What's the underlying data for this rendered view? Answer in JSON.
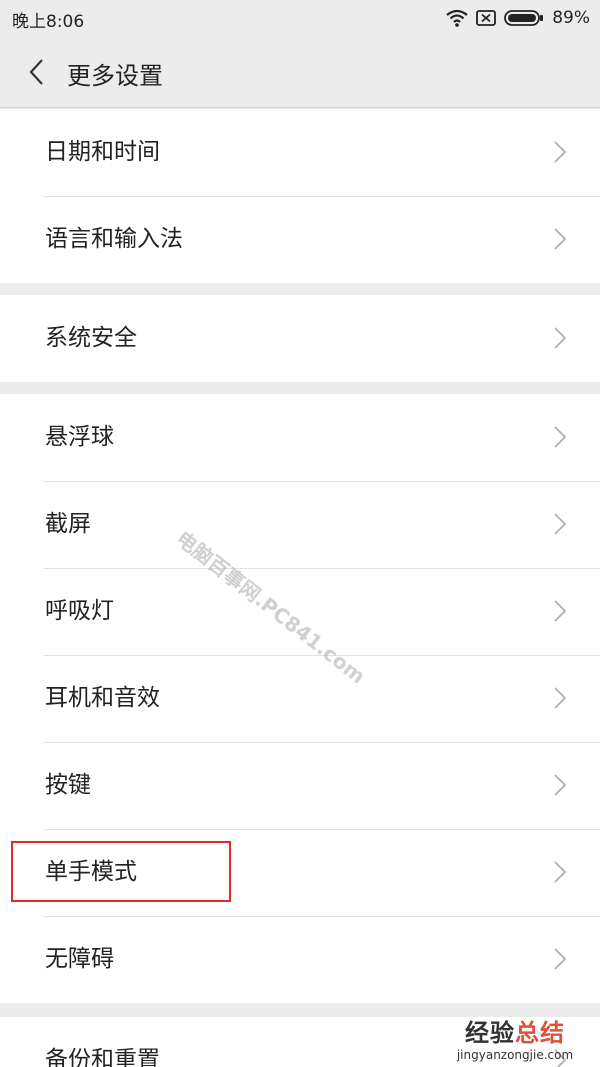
{
  "status_bar": {
    "time": "晚上8:06",
    "battery_pct": "89%"
  },
  "header": {
    "title": "更多设置"
  },
  "sections": [
    {
      "items": [
        {
          "label": "日期和时间"
        },
        {
          "label": "语言和输入法"
        }
      ]
    },
    {
      "items": [
        {
          "label": "系统安全"
        }
      ]
    },
    {
      "items": [
        {
          "label": "悬浮球"
        },
        {
          "label": "截屏"
        },
        {
          "label": "呼吸灯"
        },
        {
          "label": "耳机和音效"
        },
        {
          "label": "按键"
        },
        {
          "label": "单手模式"
        },
        {
          "label": "无障碍"
        }
      ]
    },
    {
      "items": [
        {
          "label": "备份和重置"
        }
      ]
    }
  ],
  "watermark": "电脑百事网.PC841.com",
  "brand": {
    "title_main": "经验",
    "title_accent": "总结",
    "url": "jingyanzongjie.com"
  },
  "colors": {
    "background": "#ececec",
    "card": "#ffffff",
    "highlight": "#e02a2a",
    "chevron": "#b0b0b0"
  }
}
